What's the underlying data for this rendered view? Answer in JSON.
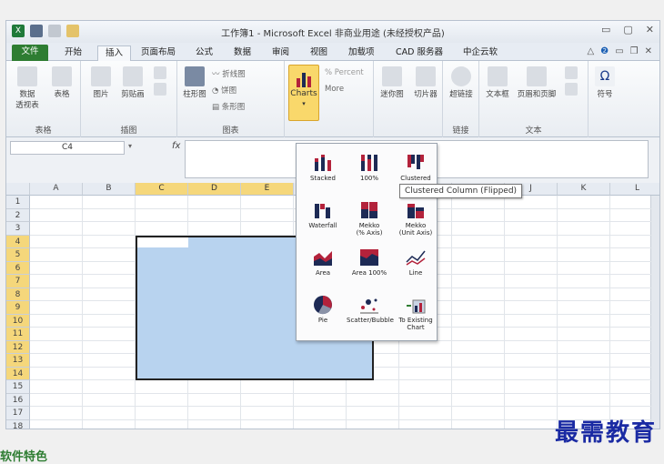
{
  "window": {
    "title": "工作簿1 - Microsoft Excel 非商业用途 (未经授权产品)",
    "controls": [
      "▭",
      "▢",
      "✕"
    ]
  },
  "tabs": [
    {
      "label": "文件",
      "kind": "file"
    },
    {
      "label": "开始"
    },
    {
      "label": "插入",
      "active": true
    },
    {
      "label": "页面布局"
    },
    {
      "label": "公式"
    },
    {
      "label": "数据"
    },
    {
      "label": "审阅"
    },
    {
      "label": "视图"
    },
    {
      "label": "加载项"
    },
    {
      "label": "CAD 服务器"
    },
    {
      "label": "中企云软"
    }
  ],
  "ribbon": {
    "groups": [
      {
        "label": "表格",
        "buttons": [
          "数据\n透视表",
          "表格"
        ]
      },
      {
        "label": "插图",
        "buttons": [
          "图片",
          "剪贴画"
        ]
      },
      {
        "label": "图表",
        "buttons": [
          "柱形图"
        ],
        "small": [
          "折线图",
          "饼图",
          "条形图"
        ]
      },
      {
        "label": "",
        "buttons": [
          "Charts"
        ],
        "small": [
          "% Percent",
          "More"
        ]
      },
      {
        "label": "",
        "buttons": [
          "迷你图",
          "切片器"
        ]
      },
      {
        "label": "链接",
        "buttons": [
          "超链接"
        ]
      },
      {
        "label": "文本",
        "buttons": [
          "文本框",
          "页眉和页脚"
        ]
      },
      {
        "label": "",
        "buttons": [
          "符号"
        ]
      }
    ]
  },
  "formula_bar": {
    "name_box": "C4",
    "fx": "fx"
  },
  "columns": [
    "A",
    "B",
    "C",
    "D",
    "E",
    "F",
    "G",
    "H",
    "I",
    "J",
    "K",
    "L"
  ],
  "rows": [
    "1",
    "2",
    "3",
    "4",
    "5",
    "6",
    "7",
    "8",
    "9",
    "10",
    "11",
    "12",
    "13",
    "14",
    "15",
    "16",
    "17",
    "18"
  ],
  "selected_columns": [
    "C",
    "D",
    "E"
  ],
  "selected_rows": [
    "4",
    "5",
    "6",
    "7",
    "8",
    "9",
    "10",
    "11",
    "12",
    "13",
    "14"
  ],
  "charts_menu": [
    {
      "label": "Stacked",
      "icon": "stacked-column-icon"
    },
    {
      "label": "100%",
      "icon": "percent-column-icon"
    },
    {
      "label": "Clustered",
      "icon": "clustered-column-icon"
    },
    {
      "label": "Waterfall",
      "icon": "waterfall-chart-icon"
    },
    {
      "label": "Mekko\n(% Axis)",
      "icon": "mekko-percent-icon"
    },
    {
      "label": "Mekko\n(Unit Axis)",
      "icon": "mekko-unit-icon"
    },
    {
      "label": "Area",
      "icon": "area-chart-icon"
    },
    {
      "label": "Area 100%",
      "icon": "area-100-icon"
    },
    {
      "label": "Line",
      "icon": "line-chart-icon"
    },
    {
      "label": "Pie",
      "icon": "pie-chart-icon"
    },
    {
      "label": "Scatter/Bubble",
      "icon": "scatter-bubble-icon"
    },
    {
      "label": "To Existing\nChart",
      "icon": "to-existing-chart-icon"
    }
  ],
  "tooltip": "Clustered Column (Flipped)",
  "watermark": "最需教育",
  "bottom_text": "软件特色",
  "colors": {
    "file_tab": "#2e7d32",
    "selection_fill": "#b8d3ef",
    "header_highlight": "#f5d77b",
    "charts_button": "#f9d86b",
    "watermark": "#1a2aa3",
    "chart_red": "#b3223b",
    "chart_navy": "#1d2a55"
  }
}
